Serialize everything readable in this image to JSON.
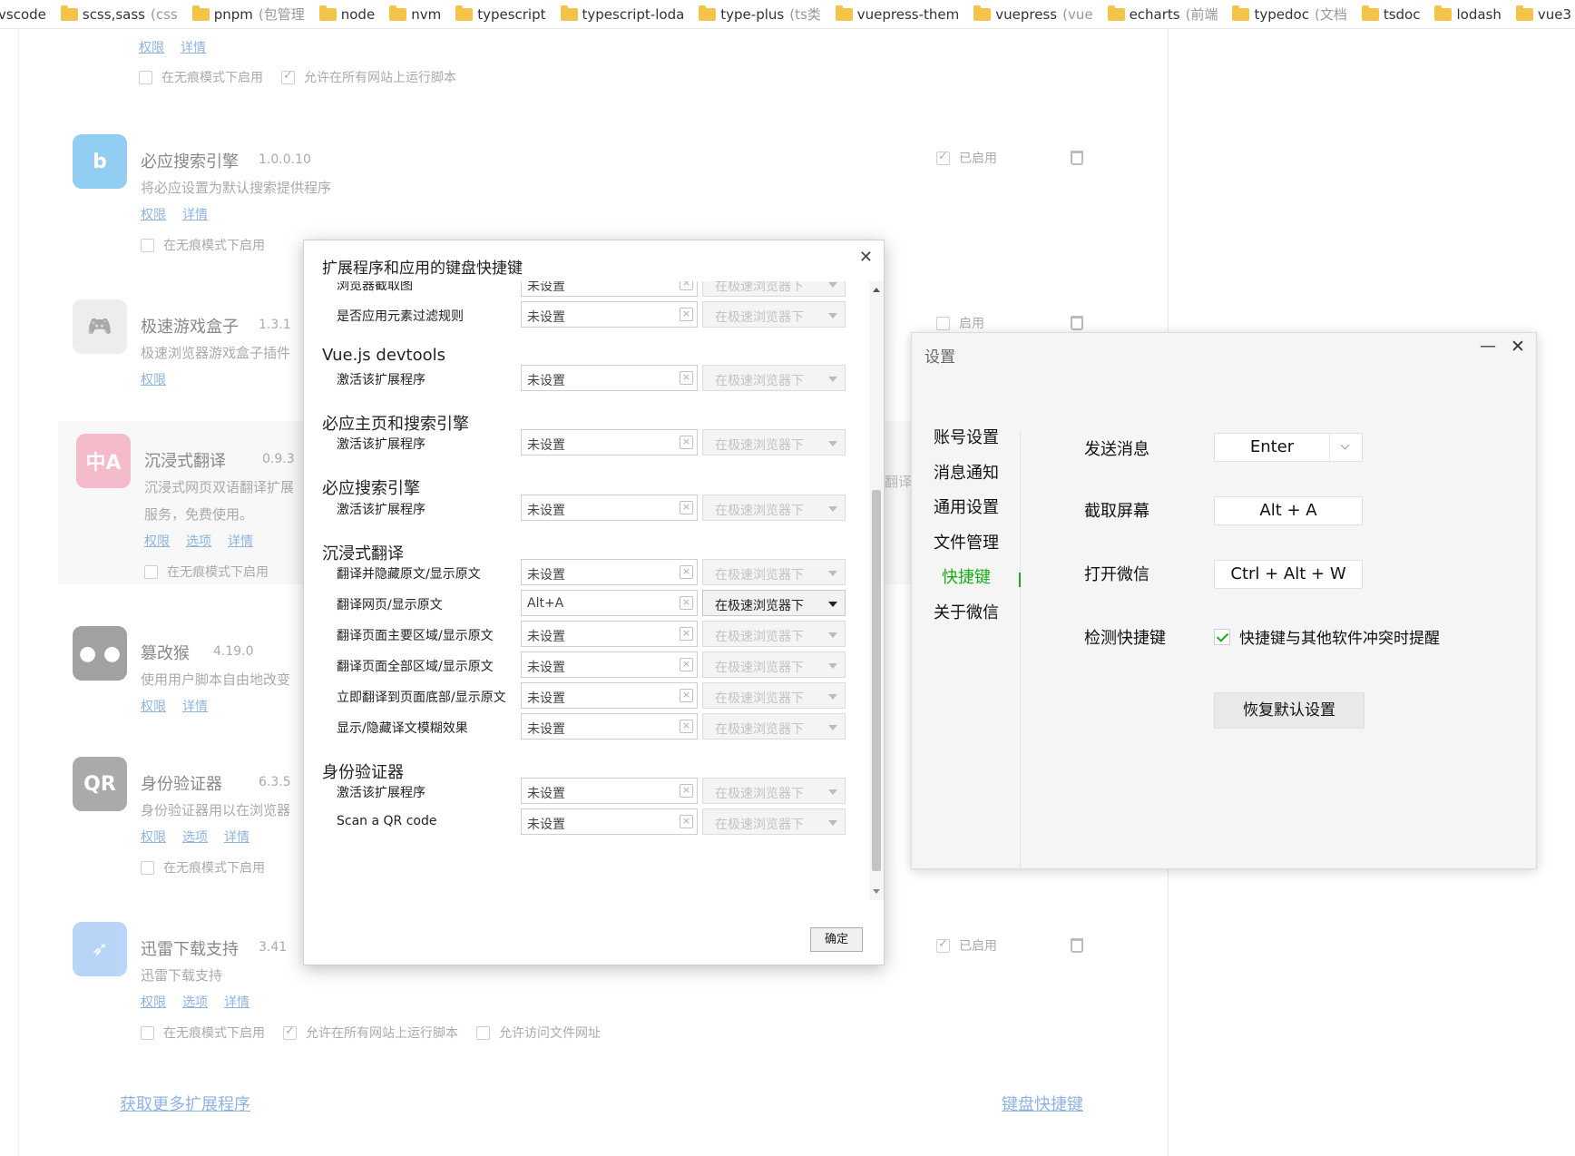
{
  "bookmarks": [
    {
      "label": "vscode",
      "sub": ""
    },
    {
      "label": "scss,sass",
      "sub": "(css"
    },
    {
      "label": "pnpm",
      "sub": "(包管理"
    },
    {
      "label": "node",
      "sub": ""
    },
    {
      "label": "nvm",
      "sub": ""
    },
    {
      "label": "typescript",
      "sub": ""
    },
    {
      "label": "typescript-loda",
      "sub": ""
    },
    {
      "label": "type-plus",
      "sub": "(ts类"
    },
    {
      "label": "vuepress-them",
      "sub": ""
    },
    {
      "label": "vuepress",
      "sub": "(vue"
    },
    {
      "label": "echarts",
      "sub": "(前端"
    },
    {
      "label": "typedoc",
      "sub": "(文档"
    },
    {
      "label": "tsdoc",
      "sub": ""
    },
    {
      "label": "lodash",
      "sub": ""
    },
    {
      "label": "vue3",
      "sub": ""
    }
  ],
  "extensions": {
    "top_links": {
      "perm": "权限",
      "detail": "详情"
    },
    "top_checks": {
      "incognito": "在无痕模式下启用",
      "all_sites": "允许在所有网站上运行脚本"
    },
    "items": [
      {
        "name": "必应搜索引擎",
        "version": "1.0.0.10",
        "desc": "将必应设置为默认搜索提供程序",
        "links": [
          "权限",
          "详情"
        ],
        "incognito": "在无痕模式下启用",
        "enabled": "已启用",
        "icon_text": "b",
        "icon_color": "#3aa5e8"
      },
      {
        "name": "极速游戏盒子",
        "version": "1.3.1",
        "desc": "极速浏览器游戏盒子插件",
        "links": [
          "权限"
        ],
        "incognito": "",
        "enabled": "启用",
        "icon_text": "🎮",
        "icon_color": "#e0e0e0"
      },
      {
        "name": "沉浸式翻译",
        "version": "0.9.3",
        "desc": "沉浸式网页双语翻译扩展",
        "desc2": "服务，免费使用。",
        "links": [
          "权限",
          "选项",
          "详情"
        ],
        "incognito": "在无痕模式下启用",
        "enabled": "",
        "icon_text": "中A",
        "icon_color": "#f28aa5"
      },
      {
        "name": "篡改猴",
        "version": "4.19.0",
        "desc": "使用用户脚本自由地改变",
        "links": [
          "权限",
          "详情"
        ],
        "incognito": "",
        "enabled": "",
        "icon_text": "● ●",
        "icon_color": "#555555"
      },
      {
        "name": "身份验证器",
        "version": "6.3.5",
        "desc": "身份验证器用以在浏览器",
        "links": [
          "权限",
          "选项",
          "详情"
        ],
        "incognito": "在无痕模式下启用",
        "enabled": "",
        "icon_text": "QR",
        "icon_color": "#666666"
      },
      {
        "name": "迅雷下载支持",
        "version": "3.41",
        "desc": "迅雷下载支持",
        "links": [
          "权限",
          "选项",
          "详情"
        ],
        "incognito": "在无痕模式下启用",
        "all_sites": "允许在所有网站上运行脚本",
        "file_access": "允许访问文件网址",
        "enabled": "已启用",
        "icon_text": "➶",
        "icon_color": "#7fb2f0"
      }
    ],
    "side_text": "翻译",
    "get_more": "获取更多扩展程序",
    "keyboard_shortcuts": "键盘快捷键"
  },
  "shortcut_dialog": {
    "title": "扩展程序和应用的键盘快捷键",
    "ok": "确定",
    "cut_row": {
      "label": "浏览器截取图",
      "value": "未设置",
      "scope": "在极速浏览器下"
    },
    "row0": {
      "label": "是否应用元素过滤规则",
      "value": "未设置",
      "scope": "在极速浏览器下"
    },
    "groups": [
      {
        "title": "Vue.js devtools",
        "rows": [
          {
            "label": "激活该扩展程序",
            "value": "未设置",
            "scope": "在极速浏览器下"
          }
        ]
      },
      {
        "title": "必应主页和搜索引擎",
        "rows": [
          {
            "label": "激活该扩展程序",
            "value": "未设置",
            "scope": "在极速浏览器下"
          }
        ]
      },
      {
        "title": "必应搜索引擎",
        "rows": [
          {
            "label": "激活该扩展程序",
            "value": "未设置",
            "scope": "在极速浏览器下"
          }
        ]
      },
      {
        "title": "沉浸式翻译",
        "rows": [
          {
            "label": "翻译并隐藏原文/显示原文",
            "value": "未设置",
            "scope": "在极速浏览器下"
          },
          {
            "label": "翻译网页/显示原文",
            "value": "Alt+A",
            "scope": "在极速浏览器下"
          },
          {
            "label": "翻译页面主要区域/显示原文",
            "value": "未设置",
            "scope": "在极速浏览器下"
          },
          {
            "label": "翻译页面全部区域/显示原文",
            "value": "未设置",
            "scope": "在极速浏览器下"
          },
          {
            "label": "立即翻译到页面底部/显示原文",
            "value": "未设置",
            "scope": "在极速浏览器下"
          },
          {
            "label": "显示/隐藏译文模糊效果",
            "value": "未设置",
            "scope": "在极速浏览器下"
          }
        ]
      },
      {
        "title": "身份验证器",
        "rows": [
          {
            "label": "激活该扩展程序",
            "value": "未设置",
            "scope": "在极速浏览器下"
          },
          {
            "label": "Scan a QR code",
            "value": "未设置",
            "scope": "在极速浏览器下"
          }
        ]
      }
    ]
  },
  "wechat_settings": {
    "title": "设置",
    "min": "—",
    "close": "✕",
    "nav": [
      "账号设置",
      "消息通知",
      "通用设置",
      "文件管理",
      "快捷键",
      "关于微信"
    ],
    "active_nav": "快捷键",
    "send_label": "发送消息",
    "send_value": "Enter",
    "capture_label": "截取屏幕",
    "capture_value": "Alt + A",
    "open_label": "打开微信",
    "open_value": "Ctrl + Alt + W",
    "detect_label": "检测快捷键",
    "detect_check": "快捷键与其他软件冲突时提醒",
    "reset": "恢复默认设置",
    "accent": "#1aad19"
  }
}
